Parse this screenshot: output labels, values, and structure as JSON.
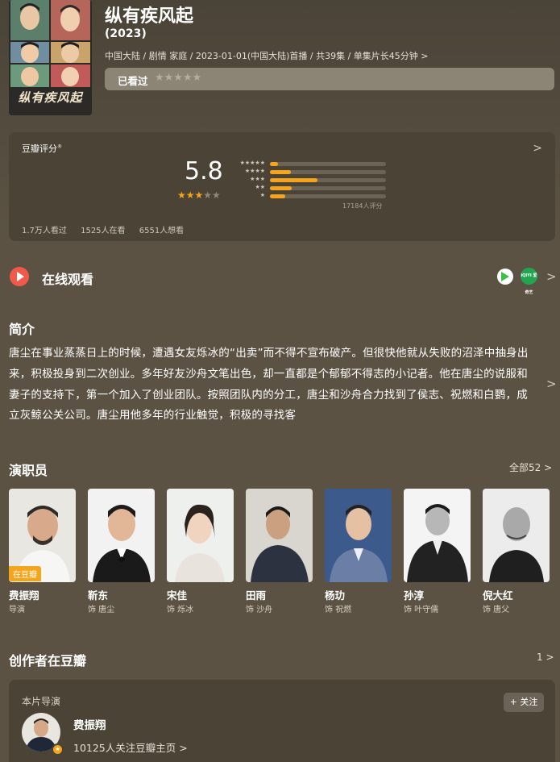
{
  "header": {
    "title": "纵有疾风起",
    "year": "(2023)",
    "meta": "中国大陆 / 剧情 家庭 / 2023-01-01(中国大陆)首播 / 共39集 / 单集片长45分钟",
    "meta_chevron": ">",
    "poster_title": "纵有疾风起",
    "seen_label": "已看过",
    "seen_stars": "★★★★★"
  },
  "rating": {
    "title": "豆瓣评分",
    "title_mark": "®",
    "chevron": ">",
    "score": "5.8",
    "stars_filled": "★★★",
    "stars_empty": "★★",
    "accent": "#f4a51c",
    "breakdown": [
      {
        "stars": "★★★★★",
        "fraction": 0.07
      },
      {
        "stars": "★★★★",
        "fraction": 0.18
      },
      {
        "stars": "★★★",
        "fraction": 0.41
      },
      {
        "stars": "★★",
        "fraction": 0.19
      },
      {
        "stars": "★",
        "fraction": 0.13
      }
    ],
    "count": "17184人评分",
    "stats": [
      "1.7万人看过",
      "1525人在看",
      "6551人想看"
    ]
  },
  "online": {
    "title": "在线观看",
    "icons": [
      "play-icon",
      "iqiyi-icon"
    ],
    "platform2_text": "iQIYI 爱奇艺",
    "chevron": ">"
  },
  "synopsis": {
    "title": "简介",
    "text": "唐尘在事业蒸蒸日上的时候，遭遇女友烁冰的“出卖”而不得不宣布破产。但很快他就从失败的沼泽中抽身出来，积极投身到二次创业。多年好友沙舟文笔出色，却一直都是个郁郁不得志的小记者。他在唐尘的说服和妻子的支持下，第一个加入了创业团队。按照团队内的分工，唐尘和沙舟合力找到了侯志、祝燃和白鹦，成立灰鲸公关公司。唐尘用他多年的行业触觉，积极的寻找客",
    "chevron": ">"
  },
  "cast": {
    "title": "演职员",
    "all_label": "全部52",
    "chevron": ">",
    "badge": "在豆瓣",
    "members": [
      {
        "name": "费振翔",
        "role": "导演"
      },
      {
        "name": "靳东",
        "role": "饰 唐尘"
      },
      {
        "name": "宋佳",
        "role": "饰 烁冰"
      },
      {
        "name": "田雨",
        "role": "饰 沙舟"
      },
      {
        "name": "杨玏",
        "role": "饰 祝燃"
      },
      {
        "name": "孙淳",
        "role": "饰 叶守儒"
      },
      {
        "name": "倪大红",
        "role": "饰 唐父"
      }
    ]
  },
  "creators": {
    "title": "创作者在豆瓣",
    "count": "1",
    "chevron": ">",
    "director_label": "本片导演",
    "name": "费振翔",
    "followers": "10125人关注豆瓣主页",
    "followers_chevron": ">",
    "follow_button": "+ 关注"
  }
}
